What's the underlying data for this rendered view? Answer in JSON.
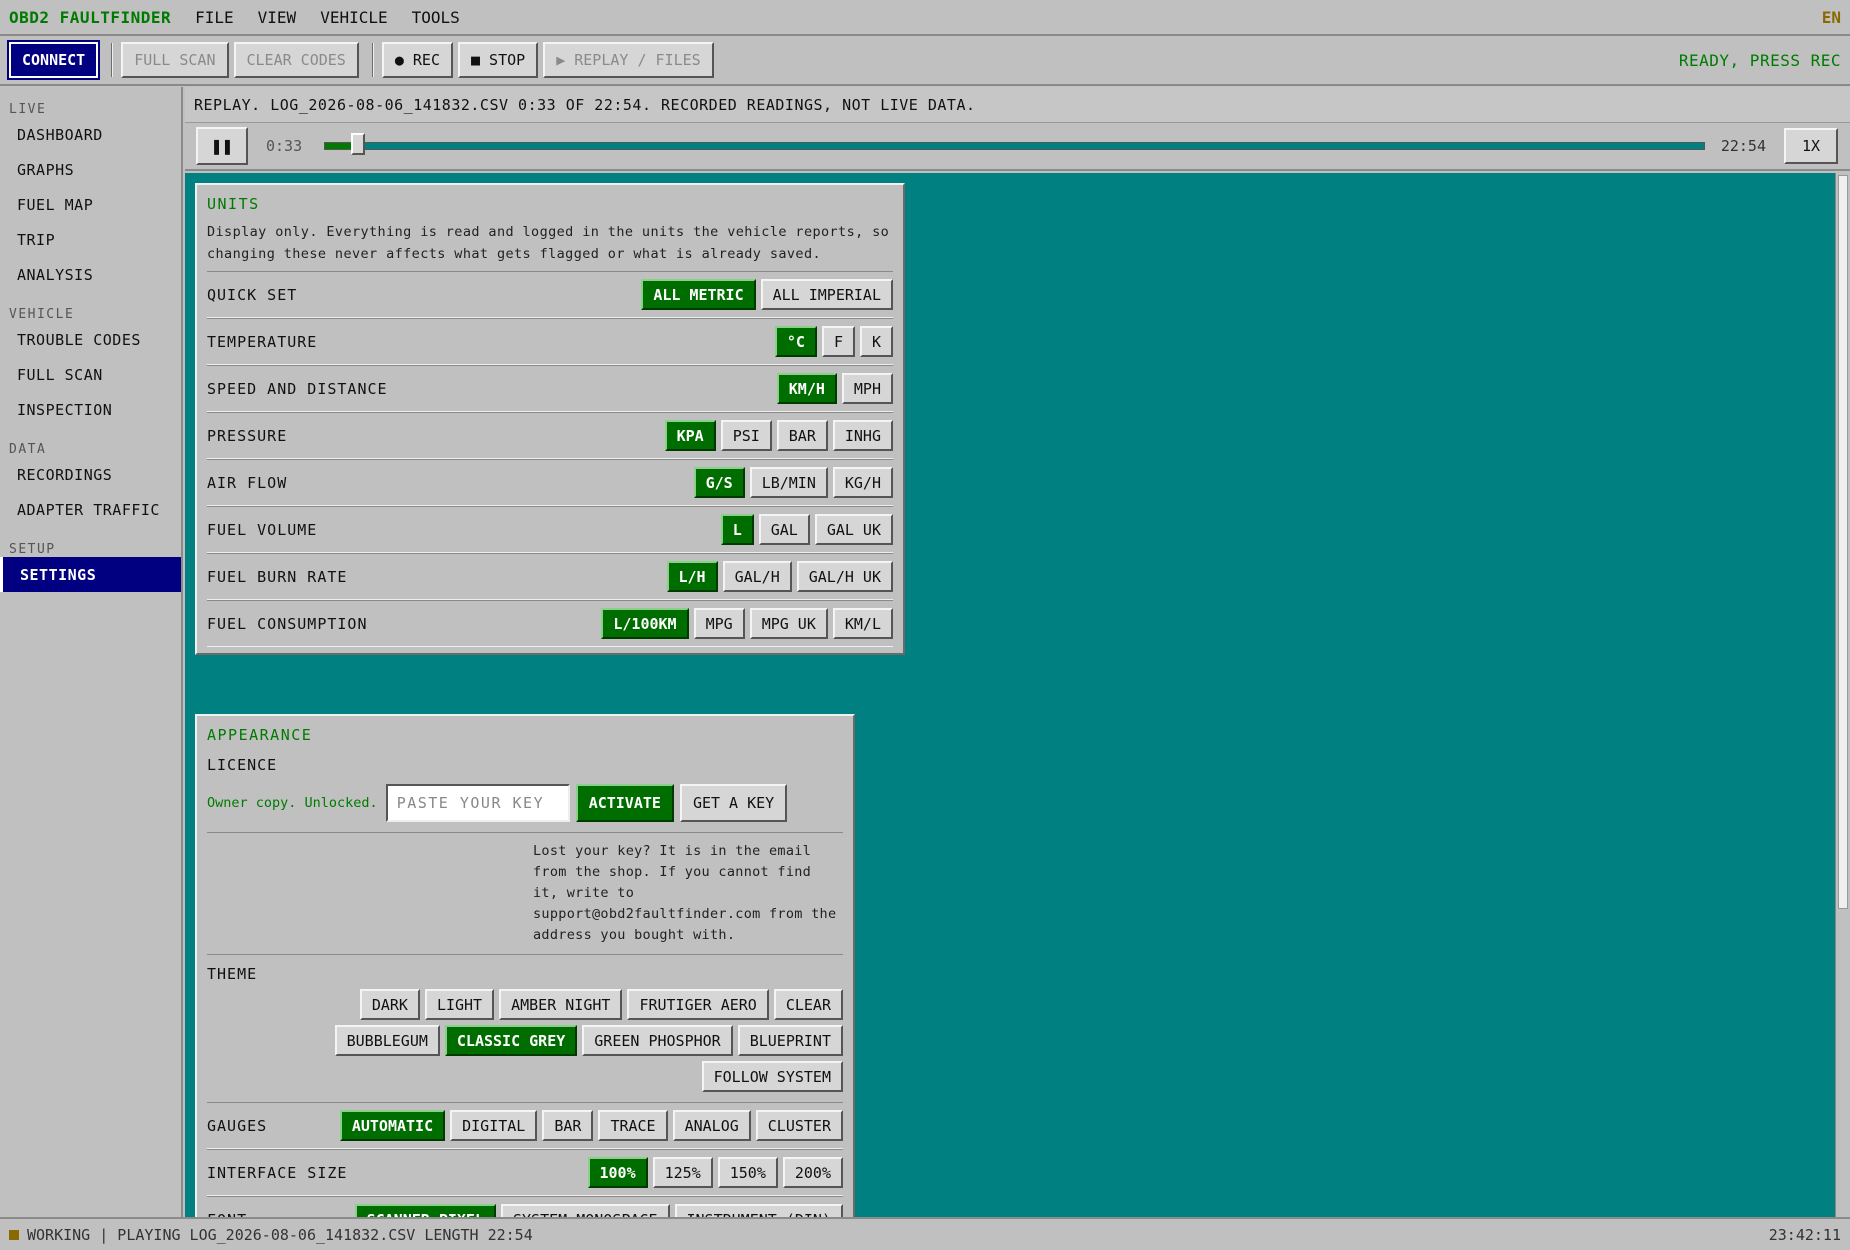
{
  "menubar": {
    "brand": "OBD2 FAULTFINDER",
    "menus": [
      "FILE",
      "VIEW",
      "VEHICLE",
      "TOOLS"
    ],
    "lang": "EN"
  },
  "toolbar": {
    "connect": "CONNECT",
    "full_scan": "FULL SCAN",
    "clear_codes": "CLEAR CODES",
    "rec": "● REC",
    "stop": "■ STOP",
    "replay_files": "▶ REPLAY / FILES",
    "status": "READY, PRESS REC"
  },
  "sidebar": {
    "sections": [
      {
        "header": "LIVE",
        "items": [
          "DASHBOARD",
          "GRAPHS",
          "FUEL MAP",
          "TRIP",
          "ANALYSIS"
        ]
      },
      {
        "header": "VEHICLE",
        "items": [
          "TROUBLE CODES",
          "FULL SCAN",
          "INSPECTION"
        ]
      },
      {
        "header": "DATA",
        "items": [
          "RECORDINGS",
          "ADAPTER TRAFFIC"
        ]
      },
      {
        "header": "SETUP",
        "items": [
          "SETTINGS"
        ]
      }
    ],
    "active": "SETTINGS"
  },
  "replay": {
    "info": "REPLAY. LOG_2026-08-06_141832.CSV 0:33 OF 22:54. RECORDED READINGS, NOT LIVE DATA.",
    "pause_icon": "pause-icon",
    "pause": "❚❚",
    "current": "0:33",
    "total": "22:54",
    "progress": 0.024,
    "speed": "1X"
  },
  "units": {
    "title": "UNITS",
    "description": "Display only. Everything is read and logged in the units the vehicle reports, so changing these never affects what gets flagged or what is already saved.",
    "rows": [
      {
        "label": "QUICK SET",
        "options": [
          "ALL METRIC",
          "ALL IMPERIAL"
        ],
        "selected": 0
      },
      {
        "label": "TEMPERATURE",
        "options": [
          "°C",
          "F",
          "K"
        ],
        "selected": 0
      },
      {
        "label": "SPEED AND DISTANCE",
        "options": [
          "KM/H",
          "MPH"
        ],
        "selected": 0
      },
      {
        "label": "PRESSURE",
        "options": [
          "KPA",
          "PSI",
          "BAR",
          "INHG"
        ],
        "selected": 0
      },
      {
        "label": "AIR FLOW",
        "options": [
          "G/S",
          "LB/MIN",
          "KG/H"
        ],
        "selected": 0
      },
      {
        "label": "FUEL VOLUME",
        "options": [
          "L",
          "GAL",
          "GAL UK"
        ],
        "selected": 0
      },
      {
        "label": "FUEL BURN RATE",
        "options": [
          "L/H",
          "GAL/H",
          "GAL/H UK"
        ],
        "selected": 0
      },
      {
        "label": "FUEL CONSUMPTION",
        "options": [
          "L/100KM",
          "MPG",
          "MPG UK",
          "KM/L"
        ],
        "selected": 0
      }
    ]
  },
  "appearance": {
    "title": "APPEARANCE",
    "licence": {
      "label": "LICENCE",
      "status": "Owner copy. Unlocked.",
      "placeholder": "PASTE YOUR KEY",
      "activate": "ACTIVATE",
      "get_key": "GET A KEY",
      "lost_key": "Lost your key? It is in the email from the shop. If you cannot find it, write to support@obd2faultfinder.com from the address you bought with."
    },
    "theme": {
      "label": "THEME",
      "rows": [
        [
          "DARK",
          "LIGHT",
          "AMBER NIGHT",
          "FRUTIGER AERO",
          "CLEAR"
        ],
        [
          "BUBBLEGUM",
          "CLASSIC GREY",
          "GREEN PHOSPHOR",
          "BLUEPRINT"
        ],
        [
          "FOLLOW SYSTEM"
        ]
      ],
      "selected": "CLASSIC GREY"
    },
    "gauges": {
      "label": "GAUGES",
      "options": [
        "AUTOMATIC",
        "DIGITAL",
        "BAR",
        "TRACE",
        "ANALOG",
        "CLUSTER"
      ],
      "selected": 0
    },
    "interface_size": {
      "label": "INTERFACE SIZE",
      "options": [
        "100%",
        "125%",
        "150%",
        "200%"
      ],
      "selected": 0
    },
    "font": {
      "label": "FONT",
      "options": [
        "SCANNER PIXEL",
        "SYSTEM MONOSPACE",
        "INSTRUMENT (DIN)"
      ],
      "selected": 0
    }
  },
  "statusbar": {
    "text": "WORKING | PLAYING LOG_2026-08-06_141832.CSV LENGTH 22:54",
    "clock": "23:42:11"
  },
  "colors": {
    "accent_green": "#006d00",
    "primary_navy": "#000080",
    "desktop_teal": "#008080",
    "chrome_grey": "#c0c0c0"
  }
}
